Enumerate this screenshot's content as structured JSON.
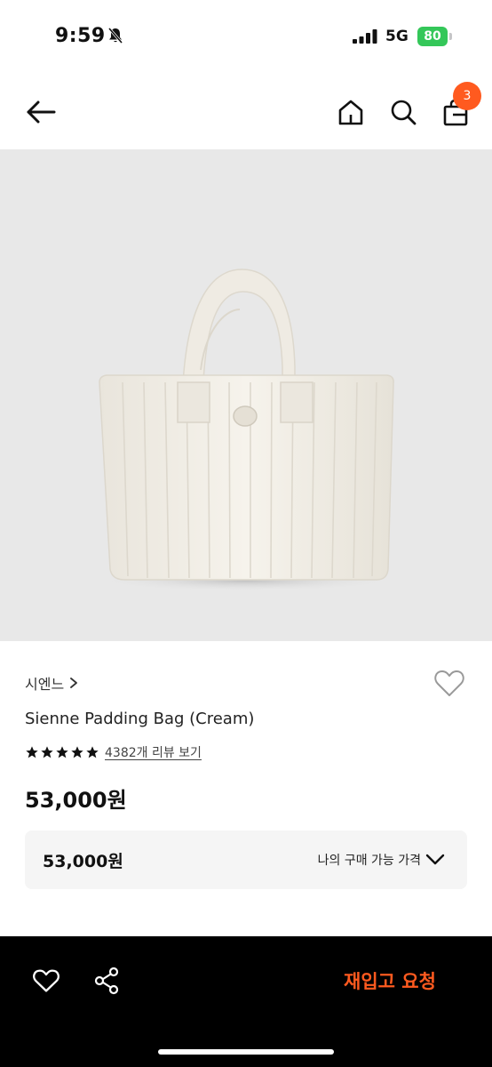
{
  "status_bar": {
    "time": "9:59",
    "network": "5G",
    "battery": "80"
  },
  "nav": {
    "cart_count": "3"
  },
  "product": {
    "brand": "시엔느",
    "name": "Sienne Padding Bag (Cream)",
    "rating_stars": 5,
    "review_link": "4382개 리뷰 보기",
    "price": "53,000원"
  },
  "price_box": {
    "price": "53,000원",
    "label": "나의 구매 가능 가격"
  },
  "bottom_bar": {
    "restock_label": "재입고 요청"
  },
  "colors": {
    "accent": "#ff5a1f",
    "battery": "#34c759",
    "image_bg": "#e8e8e8"
  },
  "icons": {
    "back": "arrow-left-icon",
    "home": "home-icon",
    "search": "search-icon",
    "cart": "shopping-bag-icon",
    "wishlist": "heart-icon",
    "share": "share-icon",
    "dropdown": "chevron-down-icon"
  }
}
